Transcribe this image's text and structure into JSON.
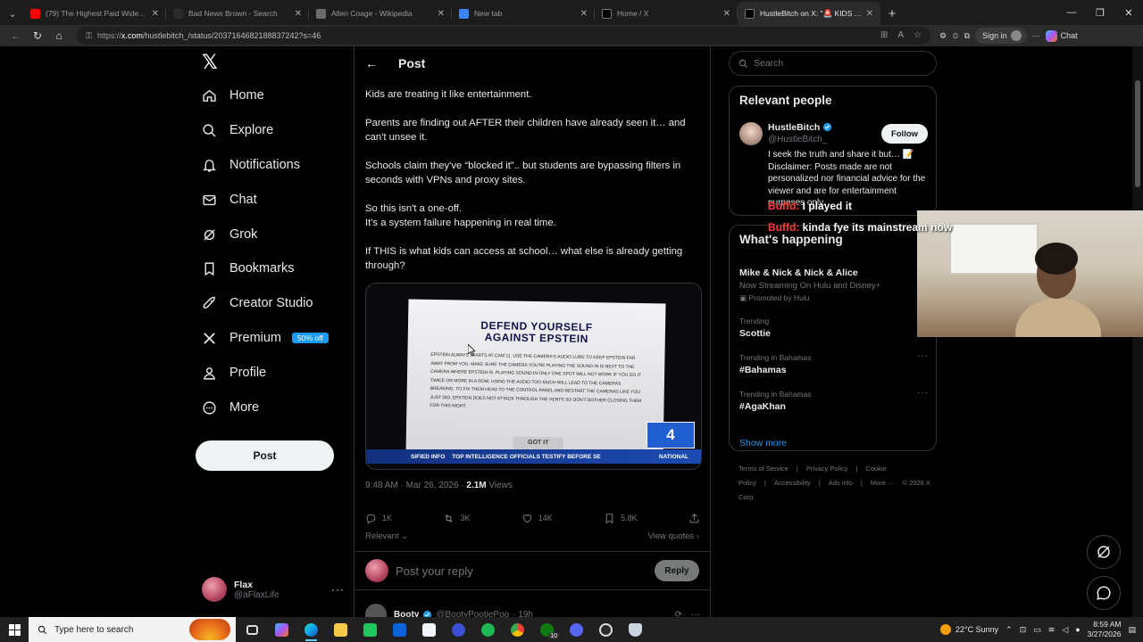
{
  "browser": {
    "tabs": [
      {
        "title": "(79) The Highest Paid Wide Receiv",
        "color": "#ff0000",
        "active": false
      },
      {
        "title": "Bad News Brown - Search",
        "color": "#2b2b2b",
        "active": false
      },
      {
        "title": "Allen Coage - Wikipedia",
        "color": "#6b6b6b",
        "active": false
      },
      {
        "title": "New tab",
        "color": "#3b82f6",
        "active": false
      },
      {
        "title": "Home / X",
        "color": "#000000",
        "active": false
      },
      {
        "title": "HustleBitch on X: \"🚨 KIDS AR",
        "color": "#000000",
        "active": true
      }
    ],
    "url_prefix": "https://",
    "url_host": "x.com",
    "url_path": "/hustlebitch_/status/2037164682188837242?s=46",
    "signin_label": "Sign in",
    "chat_label": "Chat"
  },
  "nav": {
    "items": [
      {
        "label": "Home",
        "icon": "home-icon"
      },
      {
        "label": "Explore",
        "icon": "search-icon"
      },
      {
        "label": "Notifications",
        "icon": "bell-icon"
      },
      {
        "label": "Chat",
        "icon": "mail-icon"
      },
      {
        "label": "Grok",
        "icon": "grok-icon"
      },
      {
        "label": "Bookmarks",
        "icon": "bookmark-icon"
      },
      {
        "label": "Creator Studio",
        "icon": "rocket-icon"
      },
      {
        "label": "Premium",
        "icon": "x-icon"
      },
      {
        "label": "Profile",
        "icon": "person-icon"
      },
      {
        "label": "More",
        "icon": "more-icon"
      }
    ],
    "premium_badge": "50% off",
    "post_button": "Post",
    "account": {
      "name": "Flax",
      "handle": "@aFlaxLife"
    }
  },
  "post": {
    "header": "Post",
    "paragraphs": [
      [
        "Kids are treating it like entertainment."
      ],
      [
        "Parents are finding out AFTER their children have already seen it… and can't unsee it."
      ],
      [
        "Schools claim they've “blocked it”.. but students are bypassing filters in seconds with VPNs and proxy sites."
      ],
      [
        "So this isn't a one-off.",
        "It's a system failure happening in real time."
      ],
      [
        "If THIS is what kids can access at school… what else is already getting through?"
      ]
    ],
    "media": {
      "headline": "DEFEND YOURSELF AGAINST EPSTEIN",
      "body": "Epstein always starts at cam 11. Use the camera's audio lure to keep Epstein far away from you. Make sure the camera you're playing the sound in is next to the camera where Epstein is. Playing sound in only one spot will not work if you do it twice or more in a row. Using the audio too much will lead to the cameras breaking. To fix them head to the control panel and restart the cameras like you just did. Epstein does not attack through the vents so don't bother closing them for this night.",
      "button": "GOT IT",
      "ticker_left": "SIFIED INFO",
      "ticker_main": "TOP INTELLIGENCE OFFICIALS TESTIFY BEFORE SE",
      "ticker_right": "NATIONAL",
      "station": "4"
    },
    "time": "9:48 AM · Mar 26, 2026 · ",
    "views_count": "2.1M",
    "views_label": " Views",
    "stats": {
      "replies": "1K",
      "reposts": "3K",
      "likes": "14K",
      "bookmarks": "5.8K"
    },
    "relevant": "Relevant",
    "view_quotes": "View quotes",
    "reply_placeholder": "Post your reply",
    "reply_button": "Reply",
    "next_reply": {
      "name": "Booty",
      "handle": "@BootyPootiePoo",
      "time": "· 19h"
    }
  },
  "right": {
    "search_placeholder": "Search",
    "relevant_title": "Relevant people",
    "person": {
      "name": "HustleBitch",
      "handle": "@HustleBitch_",
      "follow": "Follow",
      "bio": "I seek the truth and share it but… 📝 Disclaimer: Posts made are not personalized nor financial advice for the viewer and are for entertainment purposes only."
    },
    "happening_title": "What's happening",
    "trends": [
      {
        "category": "",
        "title": "Mike & Nick & Nick & Alice",
        "sub": "Now Streaming On Hulu and Disney+",
        "promo": "Promoted by Hulu"
      },
      {
        "category": "Trending",
        "title": "Scottie",
        "sub": "",
        "promo": ""
      },
      {
        "category": "Trending in Bahamas",
        "title": "#Bahamas",
        "sub": "",
        "promo": ""
      },
      {
        "category": "Trending in Bahamas",
        "title": "#AgaKhan",
        "sub": "",
        "promo": ""
      }
    ],
    "show_more": "Show more",
    "footer_links": [
      "Terms of Service",
      "|",
      "Privacy Policy",
      "|",
      "Cookie Policy",
      "|",
      "Accessibility",
      "|",
      "Ads info",
      "|",
      "More ···",
      "© 2026 X Corp."
    ]
  },
  "overlay": {
    "chat": [
      {
        "user": "Buffd",
        "sep": ": ",
        "msg": "I played it"
      },
      {
        "user": "Buffd",
        "sep": ": ",
        "msg": "kinda fye its mainstream now"
      }
    ]
  },
  "taskbar": {
    "search_placeholder": "Type here to search",
    "weather": "22°C  Sunny",
    "time": "8:59 AM",
    "date": "3/27/2026",
    "notif_count": "10"
  }
}
